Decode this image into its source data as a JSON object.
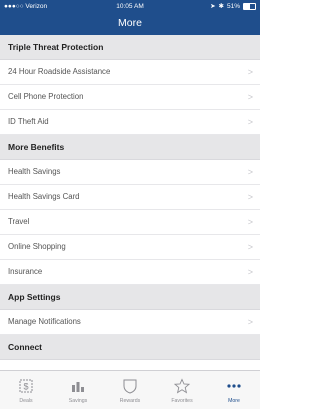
{
  "status_bar": {
    "carrier": "●●●○○ Verizon",
    "time": "10:05 AM",
    "battery": "51%"
  },
  "header": {
    "title": "More"
  },
  "sections": [
    {
      "title": "Triple Threat Protection",
      "items": [
        "24 Hour Roadside Assistance",
        "Cell Phone Protection",
        "ID Theft Aid"
      ]
    },
    {
      "title": "More Benefits",
      "items": [
        "Health Savings",
        "Health Savings Card",
        "Travel",
        "Online Shopping",
        "Insurance"
      ]
    },
    {
      "title": "App Settings",
      "items": [
        "Manage Notifications"
      ]
    },
    {
      "title": "Connect",
      "items": []
    }
  ],
  "tabs": [
    {
      "label": "Deals",
      "icon": "deals-icon"
    },
    {
      "label": "Savings",
      "icon": "savings-icon"
    },
    {
      "label": "Rewards",
      "icon": "rewards-icon"
    },
    {
      "label": "Favorites",
      "icon": "favorites-icon"
    },
    {
      "label": "More",
      "icon": "more-icon"
    }
  ],
  "colors": {
    "nav": "#1f4e8c",
    "section_bg": "#e6e6e8",
    "active_tab": "#1f4e8c"
  }
}
